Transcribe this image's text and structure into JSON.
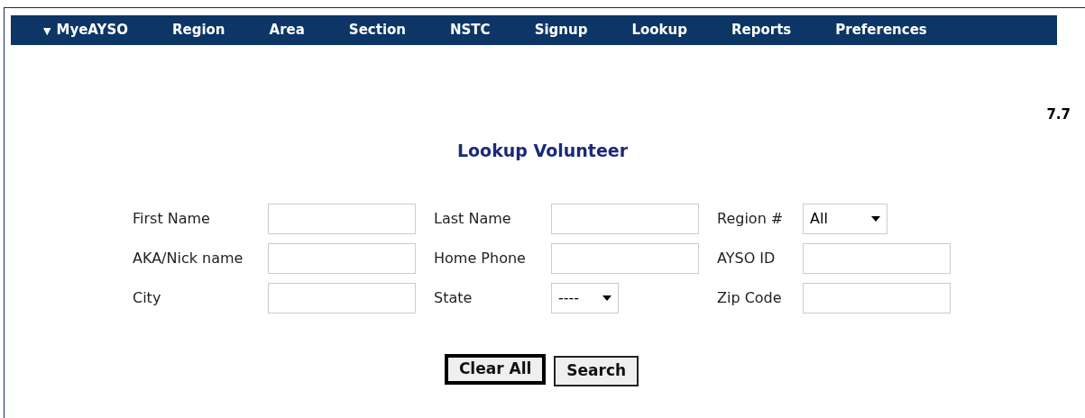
{
  "nav": {
    "items": [
      {
        "label": "MyeAYSO",
        "caret": "▼"
      },
      {
        "label": "Region"
      },
      {
        "label": "Area"
      },
      {
        "label": "Section"
      },
      {
        "label": "NSTC"
      },
      {
        "label": "Signup"
      },
      {
        "label": "Lookup"
      },
      {
        "label": "Reports"
      },
      {
        "label": "Preferences"
      }
    ]
  },
  "version": "7.7",
  "title": "Lookup Volunteer",
  "form": {
    "rows": [
      [
        {
          "label": "First Name",
          "kind": "text"
        },
        {
          "label": "Last Name",
          "kind": "text"
        },
        {
          "label": "Region #",
          "kind": "select",
          "value": "All"
        }
      ],
      [
        {
          "label": "AKA/Nick name",
          "kind": "text"
        },
        {
          "label": "Home Phone",
          "kind": "text"
        },
        {
          "label": "AYSO ID",
          "kind": "text"
        }
      ],
      [
        {
          "label": "City",
          "kind": "text"
        },
        {
          "label": "State",
          "kind": "select",
          "value": "----"
        },
        {
          "label": "Zip Code",
          "kind": "text"
        }
      ]
    ]
  },
  "buttons": [
    {
      "label": "Clear All",
      "default": true
    },
    {
      "label": "Search",
      "default": false
    }
  ]
}
